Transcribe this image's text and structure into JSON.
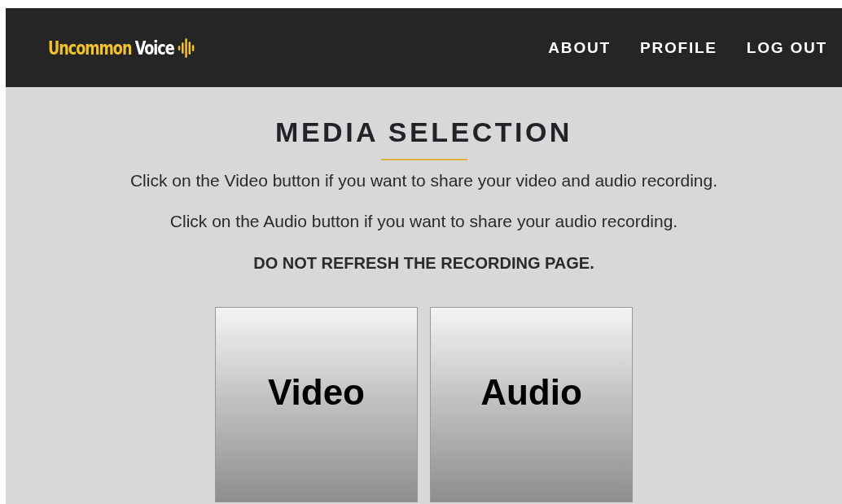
{
  "header": {
    "logo": {
      "first": "Uncommon",
      "second": "Voice"
    },
    "nav": [
      "ABOUT",
      "PROFILE",
      "LOG OUT"
    ]
  },
  "title": "MEDIA SELECTION",
  "paragraphs": [
    "Click on the Video button if you want to share your video and audio recording.",
    "Click on the Audio button if you want to share your audio recording."
  ],
  "warning": "DO NOT REFRESH THE RECORDING PAGE.",
  "buttons": [
    "Video",
    "Audio"
  ]
}
